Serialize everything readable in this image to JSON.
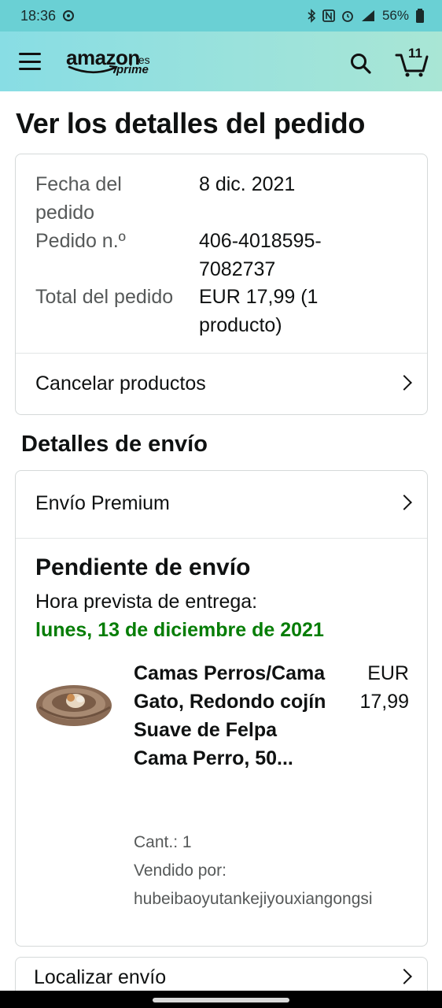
{
  "status_bar": {
    "time": "18:36",
    "battery": "56%"
  },
  "header": {
    "logo_text": "amazon",
    "logo_domain": ".es",
    "logo_prime": "prime",
    "cart_count": "11"
  },
  "page": {
    "title": "Ver los detalles del pedido"
  },
  "order_summary": {
    "rows": [
      {
        "label": "Fecha del pedido",
        "value": "8 dic. 2021"
      },
      {
        "label": "Pedido n.º",
        "value": "406-4018595-7082737"
      },
      {
        "label": "Total del pedido",
        "value": "EUR 17,99 (1 producto)"
      }
    ],
    "cancel_label": "Cancelar productos"
  },
  "shipping": {
    "section_title": "Detalles de envío",
    "method_label": "Envío Premium",
    "status_title": "Pendiente de envío",
    "eta_label": "Hora prevista de entrega:",
    "eta_date": "lunes, 13 de diciembre de 2021",
    "product": {
      "name": "Camas Perros/Cama Gato, Redondo cojín Suave de Felpa Cama Perro, 50...",
      "price": "EUR 17,99",
      "quantity": "Cant.: 1",
      "seller_label": "Vendido por:",
      "seller": "hubeibaoyutankejiyouxiangongsi"
    },
    "track_label": "Localizar envío"
  },
  "colors": {
    "header_gradient_start": "#88dde4",
    "header_gradient_end": "#a9e6d5",
    "eta_green": "#067d06"
  }
}
